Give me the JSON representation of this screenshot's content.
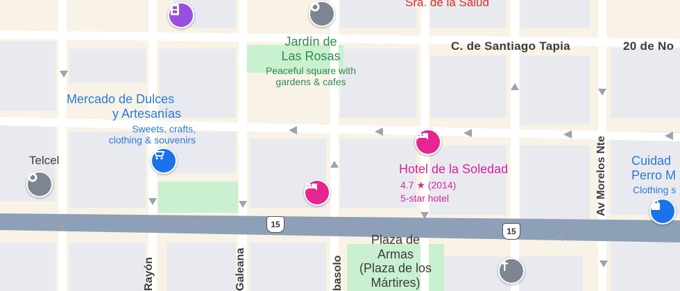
{
  "streets": {
    "santiago_tapia": "C. de Santiago Tapia",
    "veinte_de_no": "20 de No",
    "av_morelos": "Av Morelos Nte",
    "rayon": "Rayón",
    "galeana": "Galeana",
    "abasolo": "basolo"
  },
  "highway": {
    "route_number": "15"
  },
  "pois": {
    "top_red": "Sra. de la Salud",
    "jardin": {
      "title_line1": "Jardín de",
      "title_line2": "Las Rosas",
      "sub_line1": "Peaceful square with",
      "sub_line2": "gardens & cafes"
    },
    "mercado": {
      "title_line1": "Mercado de Dulces",
      "title_line2": "y Artesanías",
      "sub_line1": "Sweets, crafts,",
      "sub_line2": "clothing & souvenirs"
    },
    "telcel": "Telcel",
    "hotel": {
      "title": "Hotel de la Soledad",
      "rating": "4.7 ★ (2014)",
      "type": "5-star hotel"
    },
    "cuidad": {
      "title_line1": "Cuidad",
      "title_line2": "Perro M",
      "sub": "Clothing s"
    },
    "plaza": {
      "line1": "Plaza de",
      "line2": "Armas",
      "line3": "(Plaza de los",
      "line4": "Mártires)"
    }
  },
  "colors": {
    "land": "#f8f3e6",
    "block": "#f5eedc",
    "building": "#e9eaef",
    "road": "#ffffff",
    "highway": "#8ea0b7",
    "park": "#c9f0cf",
    "pink": "#d6249a",
    "blue": "#2a7ad6",
    "green": "#2f8a4d",
    "grey_pin": "#7c8590",
    "purple_pin": "#9b4fe0"
  },
  "icons": {
    "film": "film-icon",
    "cart": "shopping-cart-icon",
    "bed": "bed-icon",
    "pin": "place-icon",
    "bag": "shopping-bag-icon",
    "church": "church-icon"
  }
}
